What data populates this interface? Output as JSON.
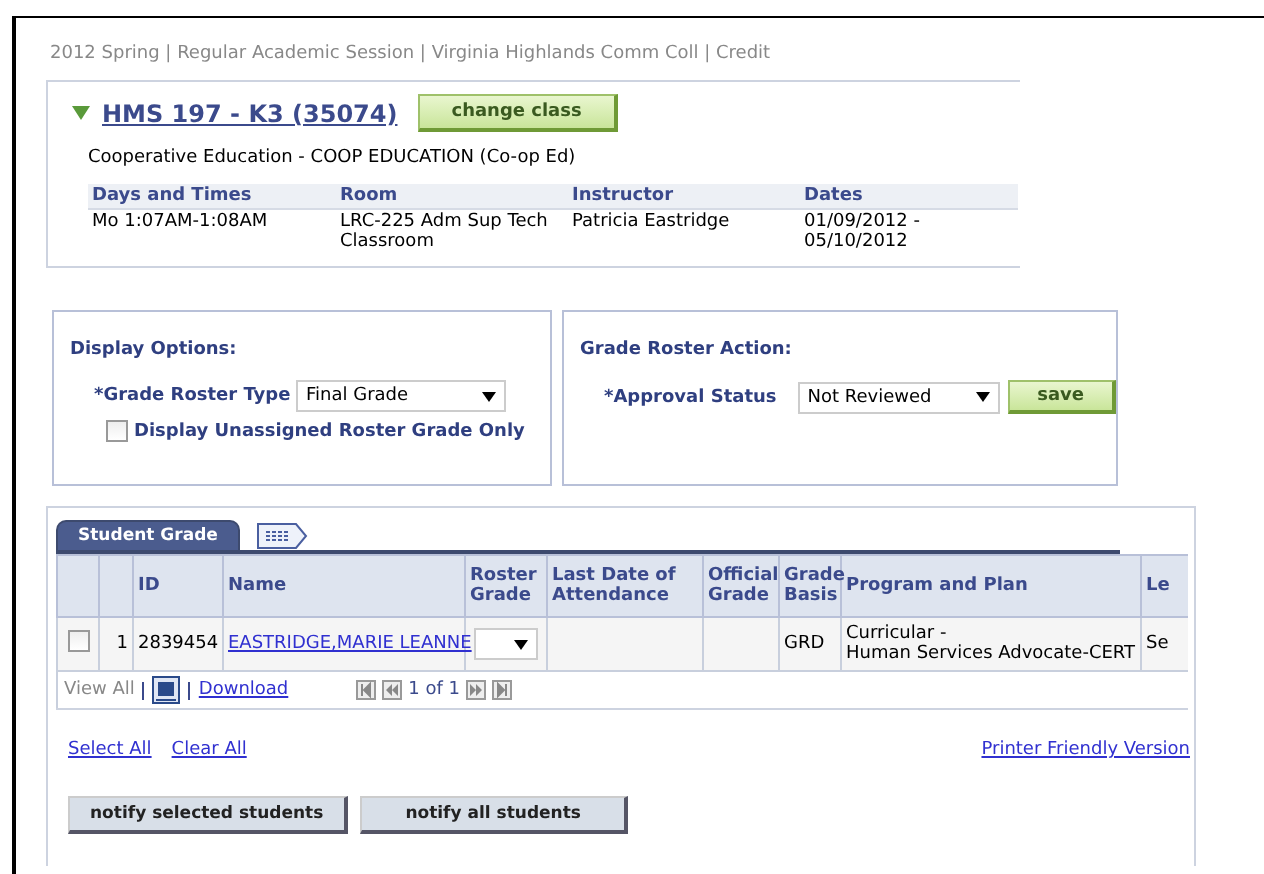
{
  "breadcrumb": "2012 Spring | Regular Academic Session | Virginia Highlands Comm Coll | Credit",
  "class_section": {
    "expanded": true,
    "title": "HMS 197 - K3 (35074)",
    "change_button": "change class",
    "description": "Cooperative Education - COOP EDUCATION (Co-op Ed)",
    "columns": [
      "Days and Times",
      "Room",
      "Instructor",
      "Dates"
    ],
    "rows": [
      [
        "Mo 1:07AM-1:08AM",
        "LRC-225 Adm Sup Tech Classroom",
        "Patricia Eastridge",
        "01/09/2012 - 05/10/2012"
      ]
    ]
  },
  "display_options": {
    "title": "Display Options:",
    "roster_type": {
      "label": "*Grade Roster Type",
      "value": "Final Grade"
    },
    "unassigned_only": {
      "label": "Display Unassigned Roster Grade Only",
      "checked": false
    }
  },
  "roster_action": {
    "title": "Grade Roster Action:",
    "approval_status": {
      "label": "*Approval Status",
      "value": "Not Reviewed"
    },
    "save_button": "save"
  },
  "grid": {
    "tabs": [
      {
        "label": "Student Grade",
        "selected": true
      }
    ],
    "columns": [
      "ID",
      "Name",
      "Roster Grade",
      "Last Date of Attendance",
      "Official Grade",
      "Grade Basis",
      "Program and Plan",
      "Le"
    ],
    "rows": [
      {
        "selected": false,
        "number": "1",
        "id": "2839454",
        "name": "EASTRIDGE,MARIE LEANNE",
        "grade_basis": "GRD",
        "program_and_plan": [
          "Curricular -",
          "Human Services Advocate-CERT"
        ],
        "column_10": "Se"
      }
    ],
    "footer": {
      "view_all": "View All",
      "download": "Download",
      "pager": "1 of 1"
    }
  },
  "links": {
    "select_all": "Select All",
    "clear_all": "Clear All",
    "printer_friendly": "Printer Friendly Version"
  },
  "buttons": [
    "notify selected students",
    "notify all students"
  ]
}
